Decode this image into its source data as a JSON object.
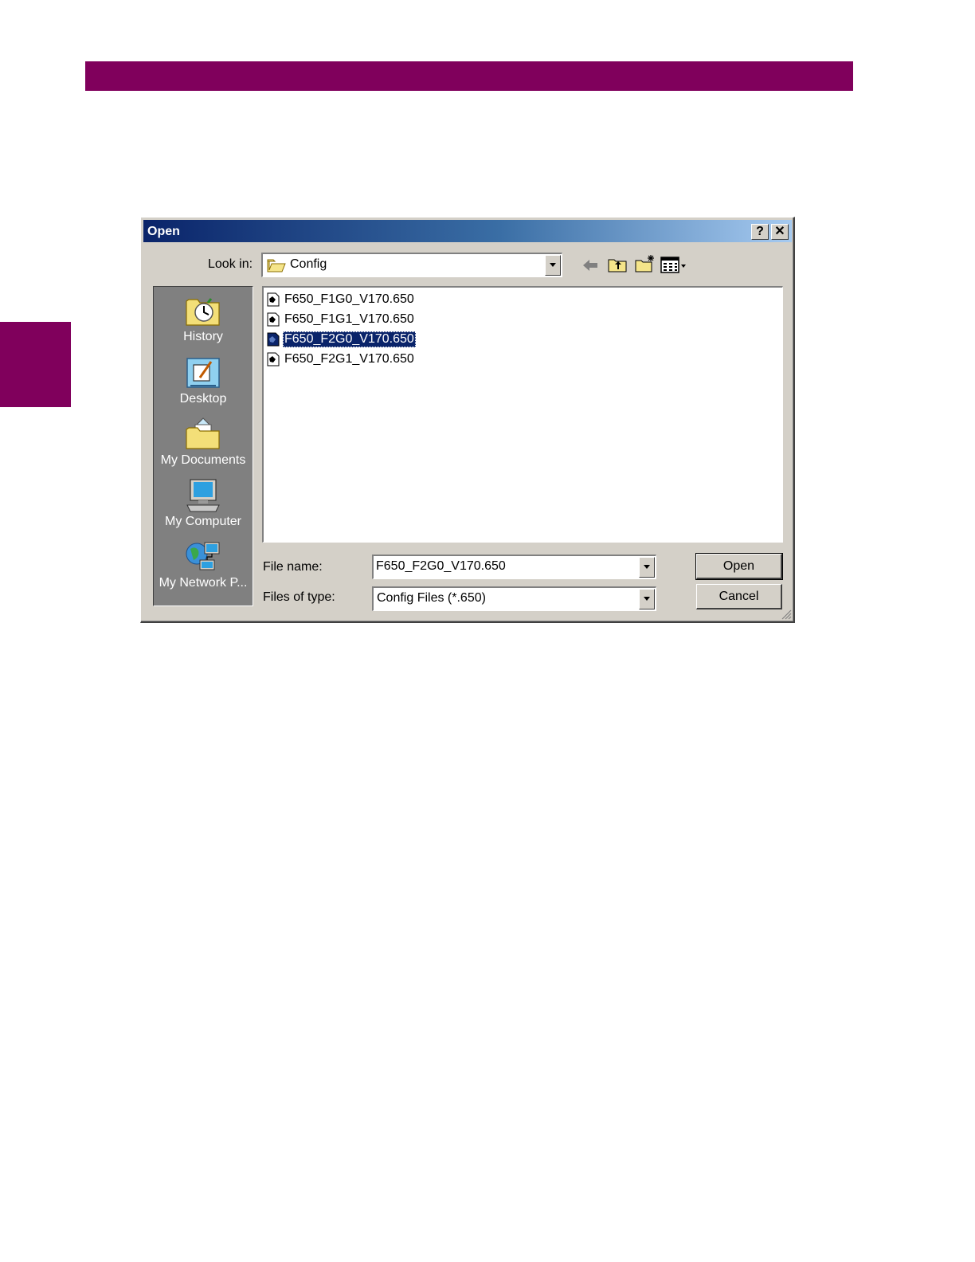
{
  "dialog": {
    "title": "Open",
    "help_glyph": "?",
    "close_glyph": "✕",
    "look_in": {
      "label": "Look in:",
      "value": "Config"
    },
    "toolbar_icons": [
      "back-arrow-icon",
      "up-folder-icon",
      "new-folder-icon",
      "view-menu-icon"
    ],
    "places": [
      {
        "label": "History",
        "icon": "history-icon"
      },
      {
        "label": "Desktop",
        "icon": "desktop-icon"
      },
      {
        "label": "My Documents",
        "icon": "my-documents-icon"
      },
      {
        "label": "My Computer",
        "icon": "my-computer-icon"
      },
      {
        "label": "My Network P...",
        "icon": "my-network-places-icon"
      }
    ],
    "files": [
      {
        "name": "F650_F1G0_V170.650",
        "selected": false
      },
      {
        "name": "F650_F1G1_V170.650",
        "selected": false
      },
      {
        "name": "F650_F2G0_V170.650",
        "selected": true
      },
      {
        "name": "F650_F2G1_V170.650",
        "selected": false
      }
    ],
    "file_name": {
      "label": "File name:",
      "value": "F650_F2G0_V170.650"
    },
    "file_type": {
      "label": "Files of type:",
      "value": "Config Files (*.650)"
    },
    "open_button": "Open",
    "cancel_button": "Cancel"
  },
  "colors": {
    "brand_bar": "#80005c",
    "titlebar_start": "#0a246a",
    "titlebar_end": "#a6caf0",
    "dialog_face": "#d4d0c8",
    "places_bar": "#808080",
    "selection": "#0a246a"
  }
}
